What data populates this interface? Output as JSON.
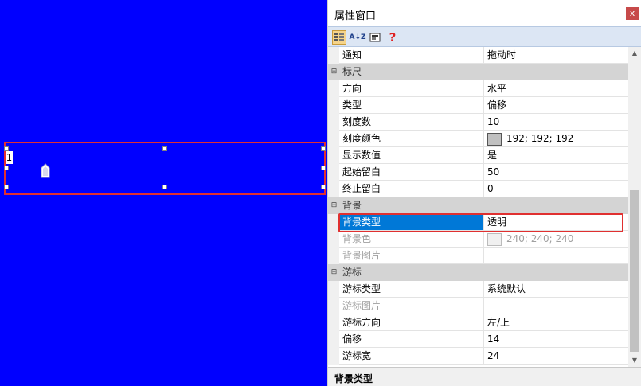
{
  "canvas": {
    "ruler_start_label": "1"
  },
  "panel": {
    "title": "属性窗口",
    "close_label": "x",
    "toolbar": {
      "sort_alpha_label": "A↓Z",
      "help_label": "?"
    },
    "rows": [
      {
        "type": "prop",
        "name": "通知",
        "value": "拖动时"
      },
      {
        "type": "cat",
        "name": "标尺",
        "toggle": "⊟"
      },
      {
        "type": "prop",
        "name": "方向",
        "value": "水平"
      },
      {
        "type": "prop",
        "name": "类型",
        "value": "偏移"
      },
      {
        "type": "prop",
        "name": "刻度数",
        "value": "10"
      },
      {
        "type": "prop",
        "name": "刻度颜色",
        "value": "192; 192; 192",
        "swatch": "#c0c0c0"
      },
      {
        "type": "prop",
        "name": "显示数值",
        "value": "是"
      },
      {
        "type": "prop",
        "name": "起始留白",
        "value": "50"
      },
      {
        "type": "prop",
        "name": "终止留白",
        "value": "0"
      },
      {
        "type": "cat",
        "name": "背景",
        "toggle": "⊟"
      },
      {
        "type": "prop",
        "name": "背景类型",
        "value": "透明",
        "selected": true
      },
      {
        "type": "prop",
        "name": "背景色",
        "value": "240; 240; 240",
        "swatch": "#f0f0f0",
        "disabled": true
      },
      {
        "type": "prop",
        "name": "背景图片",
        "value": "",
        "disabled": true
      },
      {
        "type": "cat",
        "name": "游标",
        "toggle": "⊟"
      },
      {
        "type": "prop",
        "name": "游标类型",
        "value": "系统默认"
      },
      {
        "type": "prop",
        "name": "游标图片",
        "value": "",
        "disabled": true
      },
      {
        "type": "prop",
        "name": "游标方向",
        "value": "左/上"
      },
      {
        "type": "prop",
        "name": "偏移",
        "value": "14"
      },
      {
        "type": "prop",
        "name": "游标宽",
        "value": "24"
      }
    ],
    "status": "背景类型"
  },
  "colors": {
    "canvas_bg": "#0000ff",
    "selection": "#0078d7",
    "highlight_border": "#e03030"
  }
}
